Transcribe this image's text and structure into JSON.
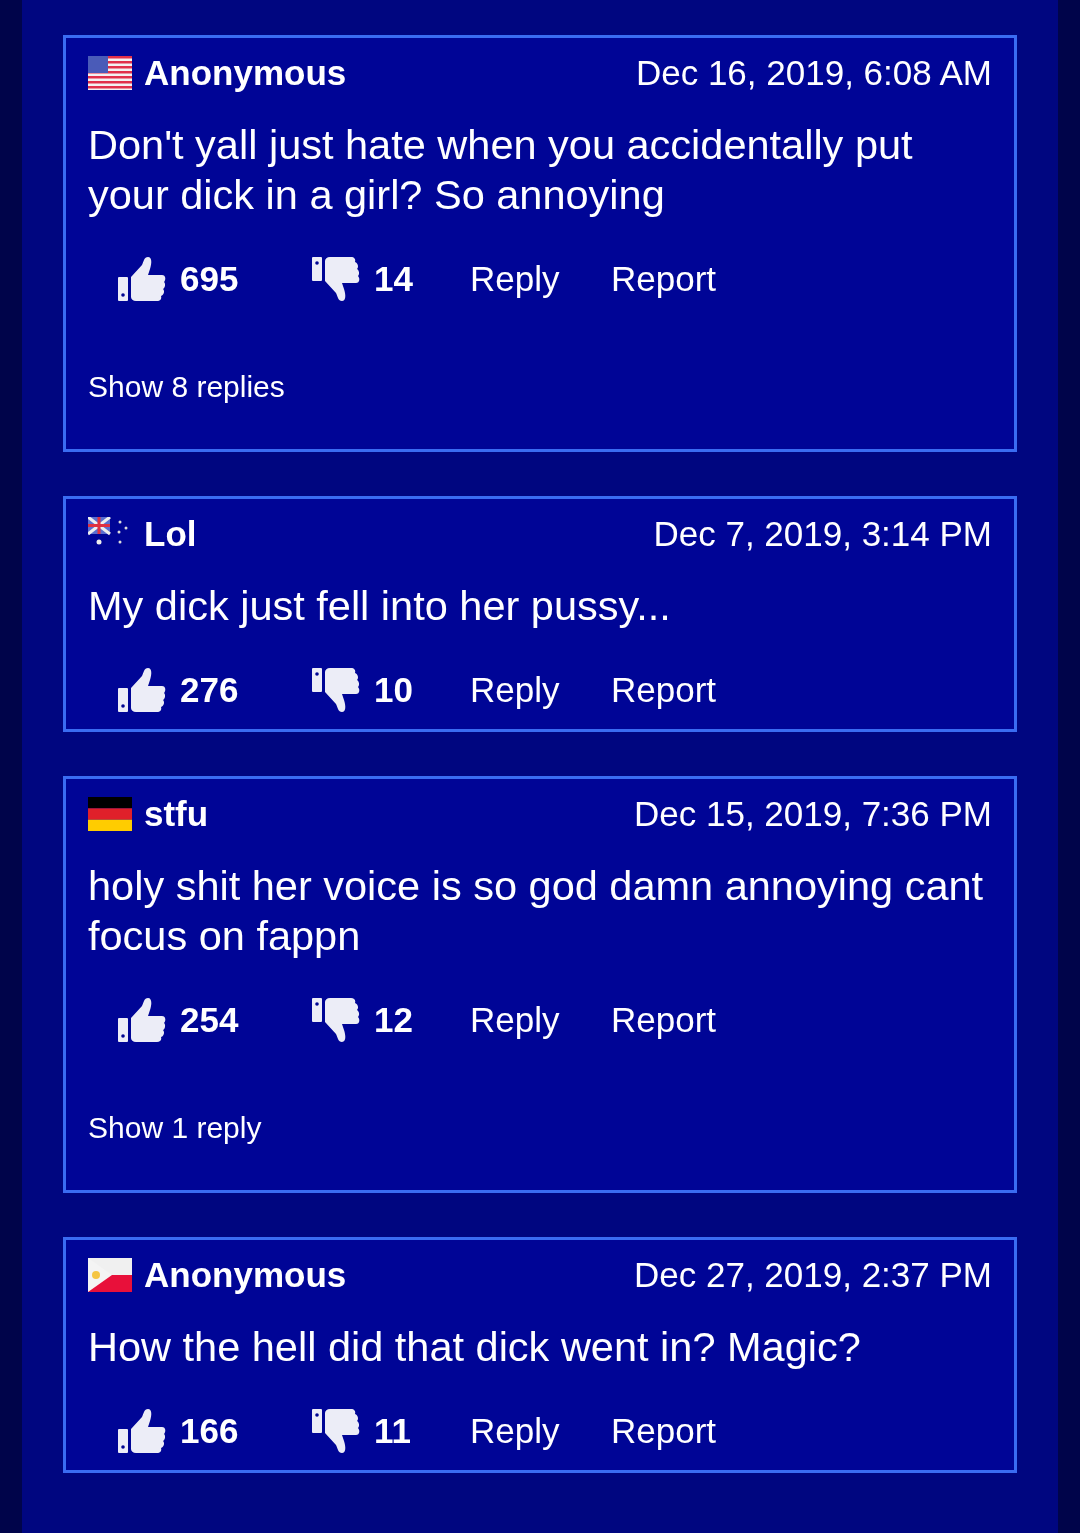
{
  "comments": [
    {
      "flag": {
        "kind": "us"
      },
      "author": "Anonymous",
      "date": "Dec 16, 2019, 6:08 AM",
      "text": "Don't yall just hate when you accidentally put your dick in a girl? So annoying",
      "likes": "695",
      "dislikes": "14",
      "reply": "Reply",
      "report": "Report",
      "replies_link": "Show 8 replies"
    },
    {
      "flag": {
        "kind": "au"
      },
      "author": "Lol",
      "date": "Dec 7, 2019, 3:14 PM",
      "text": "My dick just fell into her pussy...",
      "likes": "276",
      "dislikes": "10",
      "reply": "Reply",
      "report": "Report"
    },
    {
      "flag": {
        "kind": "de"
      },
      "author": "stfu",
      "date": "Dec 15, 2019, 7:36 PM",
      "text": "holy shit her voice is so god damn annoying cant focus on fappn",
      "likes": "254",
      "dislikes": "12",
      "reply": "Reply",
      "report": "Report",
      "replies_link": "Show 1 reply"
    },
    {
      "flag": {
        "kind": "ph"
      },
      "author": "Anonymous",
      "date": "Dec 27, 2019, 2:37 PM",
      "text": "How the hell did that dick went in? Magic?",
      "likes": "166",
      "dislikes": "11",
      "reply": "Reply",
      "report": "Report"
    }
  ]
}
